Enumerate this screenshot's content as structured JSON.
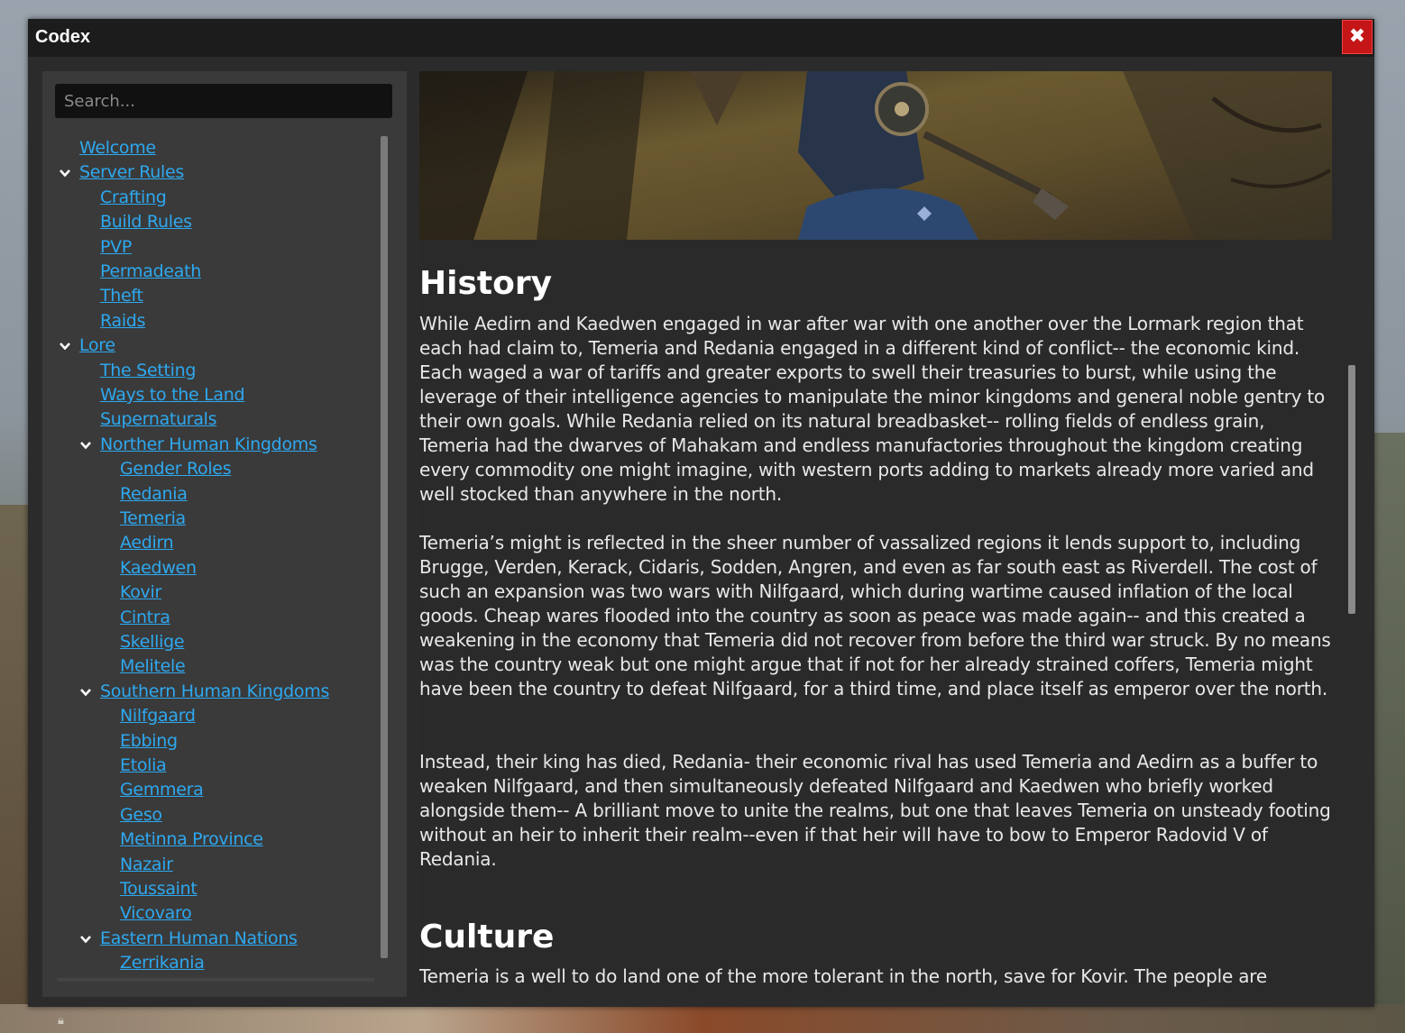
{
  "window": {
    "title": "Codex",
    "close_icon": "close-icon"
  },
  "search": {
    "placeholder": "Search..."
  },
  "nav": {
    "items": [
      {
        "label": "Welcome",
        "level": 0,
        "expanded": null
      },
      {
        "label": "Server Rules",
        "level": 0,
        "expanded": true
      },
      {
        "label": "Crafting",
        "level": 1,
        "expanded": null
      },
      {
        "label": "Build Rules",
        "level": 1,
        "expanded": null
      },
      {
        "label": "PVP",
        "level": 1,
        "expanded": null
      },
      {
        "label": "Permadeath",
        "level": 1,
        "expanded": null
      },
      {
        "label": "Theft",
        "level": 1,
        "expanded": null
      },
      {
        "label": "Raids",
        "level": 1,
        "expanded": null
      },
      {
        "label": "Lore",
        "level": 0,
        "expanded": true
      },
      {
        "label": "The Setting",
        "level": 1,
        "expanded": null
      },
      {
        "label": "Ways to the Land",
        "level": 1,
        "expanded": null
      },
      {
        "label": "Supernaturals",
        "level": 1,
        "expanded": null
      },
      {
        "label": "Norther Human Kingdoms",
        "level": 1,
        "expanded": true
      },
      {
        "label": "Gender Roles",
        "level": 2,
        "expanded": null
      },
      {
        "label": "Redania",
        "level": 2,
        "expanded": null
      },
      {
        "label": "Temeria",
        "level": 2,
        "expanded": null
      },
      {
        "label": "Aedirn",
        "level": 2,
        "expanded": null
      },
      {
        "label": "Kaedwen",
        "level": 2,
        "expanded": null
      },
      {
        "label": "Kovir",
        "level": 2,
        "expanded": null
      },
      {
        "label": "Cintra",
        "level": 2,
        "expanded": null
      },
      {
        "label": "Skellige",
        "level": 2,
        "expanded": null
      },
      {
        "label": "Melitele",
        "level": 2,
        "expanded": null
      },
      {
        "label": "Southern Human Kingdoms",
        "level": 1,
        "expanded": true
      },
      {
        "label": "Nilfgaard",
        "level": 2,
        "expanded": null
      },
      {
        "label": "Ebbing",
        "level": 2,
        "expanded": null
      },
      {
        "label": "Etolia",
        "level": 2,
        "expanded": null
      },
      {
        "label": "Gemmera",
        "level": 2,
        "expanded": null
      },
      {
        "label": "Geso",
        "level": 2,
        "expanded": null
      },
      {
        "label": "Metinna Province",
        "level": 2,
        "expanded": null
      },
      {
        "label": "Nazair",
        "level": 2,
        "expanded": null
      },
      {
        "label": "Toussaint",
        "level": 2,
        "expanded": null
      },
      {
        "label": "Vicovaro",
        "level": 2,
        "expanded": null
      },
      {
        "label": "Eastern Human Nations",
        "level": 1,
        "expanded": true
      },
      {
        "label": "Zerrikania",
        "level": 2,
        "expanded": null
      }
    ]
  },
  "content": {
    "history_heading": "History",
    "history_paragraphs": [
      "While Aedirn and Kaedwen engaged in war after war with one another over the Lormark region that each had claim to, Temeria and Redania engaged in a different kind of conflict-- the economic kind. Each waged a war of tariffs and greater exports to swell their treasuries to burst, while using the leverage of their intelligence agencies to manipulate the minor kingdoms and general noble gentry to their own goals. While Redania relied on its natural breadbasket-- rolling fields of endless grain, Temeria had the dwarves of Mahakam and endless manufactories throughout the kingdom creating every commodity one might imagine, with western ports adding to markets already more varied and well stocked than anywhere in the north.",
      "Temeria’s might is reflected in the sheer number of vassalized regions it lends support to, including Brugge, Verden, Kerack, Cidaris, Sodden, Angren, and even as far south east as Riverdell. The cost of such an expansion was two wars with Nilfgaard, which during wartime caused inflation of the local goods. Cheap wares flooded into the country as soon as peace was made again-- and this created a weakening in the economy that Temeria did not recover from before the third war struck. By no means was the country weak but one might argue that if not for her already strained coffers, Temeria might have been the country to defeat Nilfgaard, for a third time, and place itself as emperor over the north.",
      "Instead, their king has died, Redania- their economic rival has used Temeria and Aedirn as a buffer to weaken Nilfgaard, and then simultaneously defeated Nilfgaard and Kaedwen who briefly worked alongside them-- A brilliant move to unite the realms, but one that leaves Temeria on unsteady footing without an heir to inherit their realm--even if that heir will have to bow to Emperor Radovid V of Redania."
    ],
    "culture_heading": "Culture",
    "culture_paragraph": "Temeria is a well to do land one of the more tolerant in the north, save for Kovir. The people are"
  },
  "colors": {
    "link": "#2ea8ef",
    "close": "#c41616",
    "panel": "#3a3a3a",
    "content_bg": "#2a2a2a"
  }
}
